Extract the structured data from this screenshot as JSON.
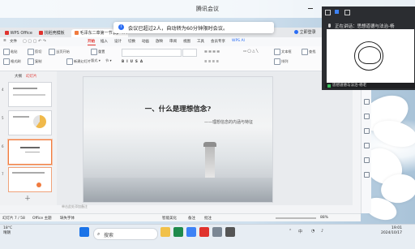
{
  "meeting": {
    "title": "腾讯会议"
  },
  "notification": {
    "text": "会议已超过2人，自动转为60分钟限时会议。"
  },
  "wps": {
    "tabs": [
      {
        "label": "WPS Office"
      },
      {
        "label": "找稻壳模板"
      },
      {
        "label": "毛泽东二章第一节.pp"
      }
    ],
    "login": "立即登录",
    "menu": [
      "文件",
      "开始",
      "插入",
      "设计",
      "切换",
      "动画",
      "放映",
      "审阅",
      "视图",
      "工具",
      "会员专享",
      "WPS AI"
    ],
    "active_menu": "开始",
    "ribbon": {
      "new_slide": "新建幻灯片",
      "layout": "版式",
      "section": "节",
      "reset": "重置",
      "paste": "粘贴",
      "format_painter": "格式刷",
      "cut": "剪切",
      "copy": "复制",
      "from_current": "当页开始",
      "text_box": "文本框",
      "arrange": "排列",
      "find": "查找"
    },
    "panel_tabs": [
      "大纲",
      "幻灯片"
    ],
    "slide_numbers": [
      "4",
      "5",
      "6",
      "7"
    ],
    "slide": {
      "title": "一、什么是理想信念?",
      "subtitle": "——理想信念的内涵与特征"
    },
    "notes_placeholder": "单击此处添加备注",
    "status": {
      "slide_info": "幻灯片 7 / 58",
      "theme": "Office 主题",
      "font_missing": "缺失字体",
      "beautify": "智能美化",
      "notes": "备注",
      "comments": "批注",
      "zoom": "88%"
    }
  },
  "video": {
    "speaker_label": "正在讲话：",
    "speaker_name": "思想道德与法治-杨",
    "caption": "思想道德与法治-杨老"
  },
  "taskbar": {
    "weather_temp": "18°C",
    "weather_desc": "晴朗",
    "search_placeholder": "搜索",
    "time": "19:01",
    "date": "2024/10/17",
    "lang": "中"
  },
  "colors": {
    "wps_red": "#e0332e",
    "accent_orange": "#f07b3f",
    "meeting_blue": "#2a6df4"
  }
}
